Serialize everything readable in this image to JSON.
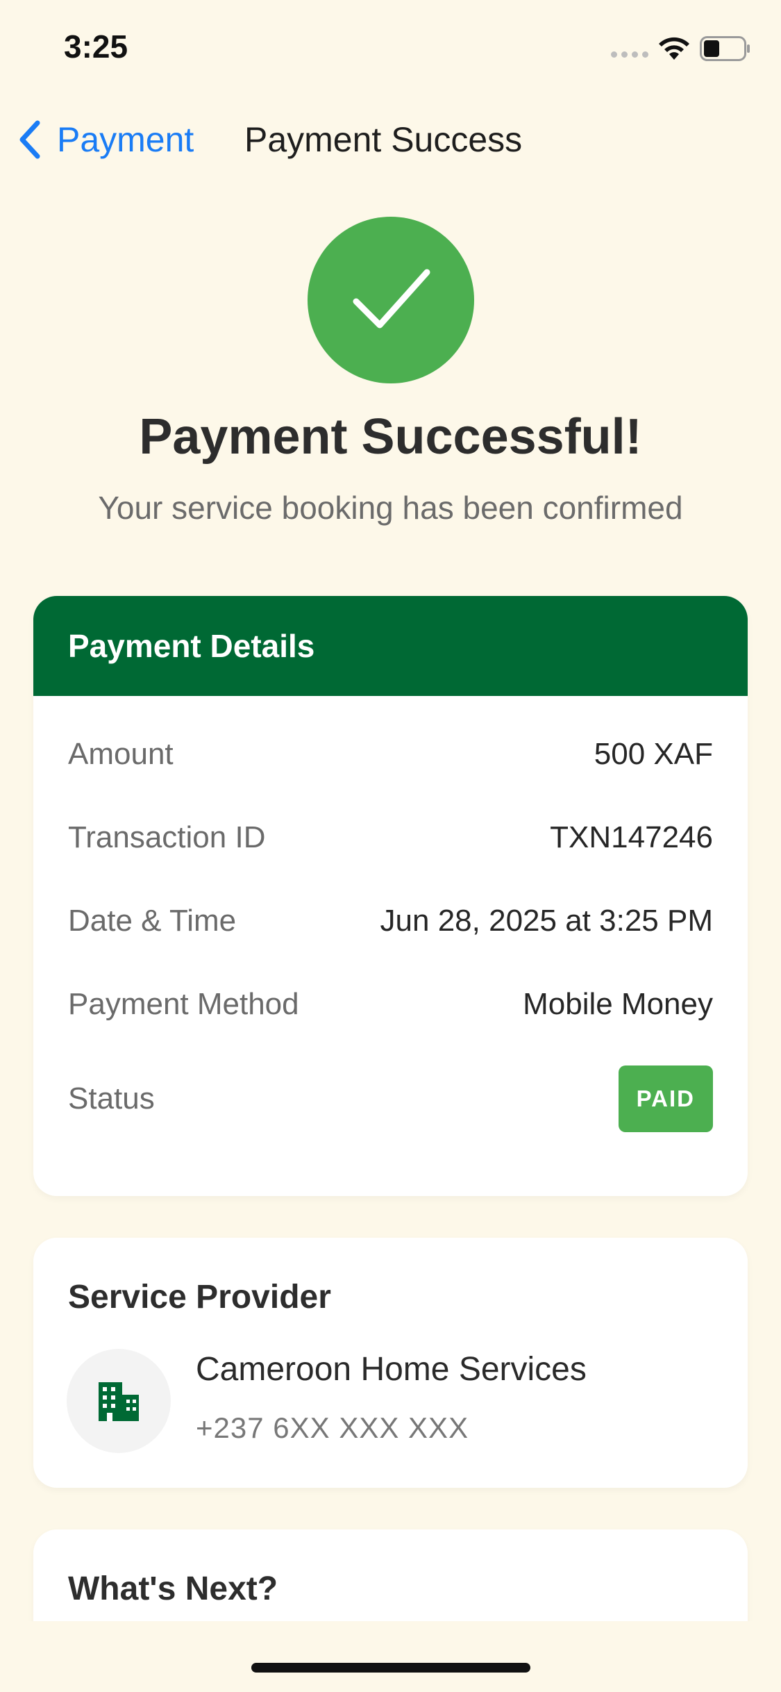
{
  "status_bar": {
    "time": "3:25",
    "icons": [
      "signal-dots-icon",
      "wifi-icon",
      "battery-icon"
    ]
  },
  "nav": {
    "back_label": "Payment",
    "title": "Payment Success"
  },
  "hero": {
    "icon": "checkmark-icon",
    "title": "Payment Successful!",
    "subtitle": "Your service booking has been confirmed"
  },
  "payment_details": {
    "header": "Payment Details",
    "rows": [
      {
        "label": "Amount",
        "value": "500 XAF"
      },
      {
        "label": "Transaction ID",
        "value": "TXN147246"
      },
      {
        "label": "Date & Time",
        "value": "Jun 28, 2025 at 3:25 PM"
      },
      {
        "label": "Payment Method",
        "value": "Mobile Money"
      }
    ],
    "status_label": "Status",
    "status_badge": "PAID"
  },
  "provider": {
    "heading": "Service Provider",
    "icon": "building-icon",
    "name": "Cameroon Home Services",
    "phone": "+237 6XX XXX XXX"
  },
  "next": {
    "heading": "What's Next?"
  },
  "colors": {
    "background": "#FDF8E9",
    "accent_green": "#4CAF50",
    "header_green": "#006934",
    "link_blue": "#1a7cf5"
  }
}
